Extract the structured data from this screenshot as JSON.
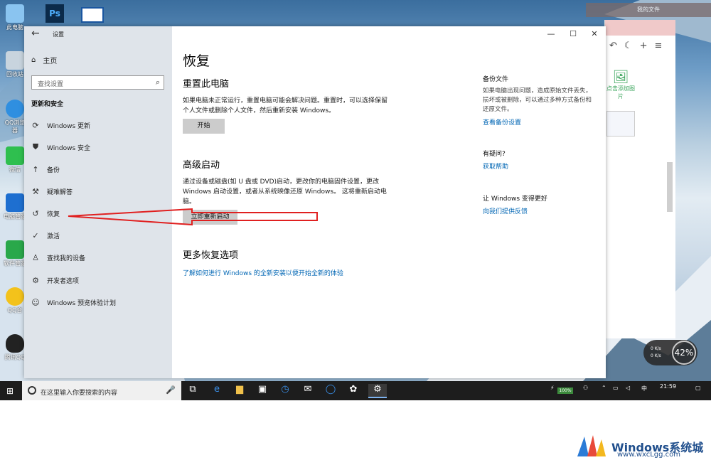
{
  "desktop": {
    "icons": [
      {
        "label": "此电脑",
        "icon": "computer-icon"
      },
      {
        "label": "回收站",
        "icon": "recycle-bin-icon"
      },
      {
        "label": "QQ浏览器",
        "icon": "qq-browser-icon"
      },
      {
        "label": "微信",
        "icon": "wechat-icon"
      },
      {
        "label": "电脑管家",
        "icon": "pc-manager-icon"
      },
      {
        "label": "软件管家",
        "icon": "software-manager-icon"
      },
      {
        "label": "QQ音",
        "icon": "qq-music-icon"
      },
      {
        "label": "腾讯QQ",
        "icon": "qq-icon"
      }
    ],
    "top_right_title": "我的文件"
  },
  "window": {
    "title": "设置",
    "back_icon": "back-arrow-icon",
    "controls": {
      "minimize": "—",
      "maximize": "☐",
      "close": "✕"
    }
  },
  "sidebar": {
    "home": "主页",
    "search_placeholder": "查找设置",
    "section": "更新和安全",
    "items": [
      {
        "label": "Windows 更新",
        "icon": "sync-icon"
      },
      {
        "label": "Windows 安全",
        "icon": "shield-icon"
      },
      {
        "label": "备份",
        "icon": "upload-icon"
      },
      {
        "label": "疑难解答",
        "icon": "wrench-icon"
      },
      {
        "label": "恢复",
        "icon": "history-icon"
      },
      {
        "label": "激活",
        "icon": "check-circle-icon"
      },
      {
        "label": "查找我的设备",
        "icon": "find-device-icon"
      },
      {
        "label": "开发者选项",
        "icon": "developer-icon"
      },
      {
        "label": "Windows 预览体验计划",
        "icon": "insider-icon"
      }
    ]
  },
  "content": {
    "title": "恢复",
    "reset": {
      "heading": "重置此电脑",
      "desc": "如果电脑未正常运行，重置电脑可能会解决问题。重置时，可以选择保留个人文件或删除个人文件，然后重新安装 Windows。",
      "button": "开始"
    },
    "advanced": {
      "heading": "高级启动",
      "desc": "通过设备或磁盘(如 U 盘或 DVD)启动，更改你的电脑固件设置，更改 Windows 启动设置，或者从系统映像还原 Windows。 这将重新启动电脑。",
      "button": "立即重新启动"
    },
    "more": {
      "heading": "更多恢复选项",
      "link": "了解如何进行 Windows 的全新安装以便开始全新的体验"
    },
    "side": {
      "backup_heading": "备份文件",
      "backup_desc": "如果电脑出现问题，造成原始文件丢失，损坏或被删除，可以通过多种方式备份和还原文件。",
      "backup_link": "查看备份设置",
      "question_heading": "有疑问?",
      "question_link": "获取帮助",
      "better_heading": "让 Windows 变得更好",
      "better_link": "向我们提供反馈"
    }
  },
  "taskbar": {
    "search_placeholder": "在这里输入你要搜索的内容",
    "battery": "100%",
    "time": "21:59"
  },
  "gauge": {
    "percent": "42%",
    "rate_up": "0 K/s",
    "rate_down": "0 K/s"
  },
  "background_window": {
    "add_picture": "点击添加图片"
  },
  "watermark": {
    "text": "Windows系统城",
    "url": "www.wxcLgg.com"
  },
  "colors": {
    "link": "#0066b4",
    "arrow": "#e02020",
    "taskbar": "#1d1d1d"
  }
}
